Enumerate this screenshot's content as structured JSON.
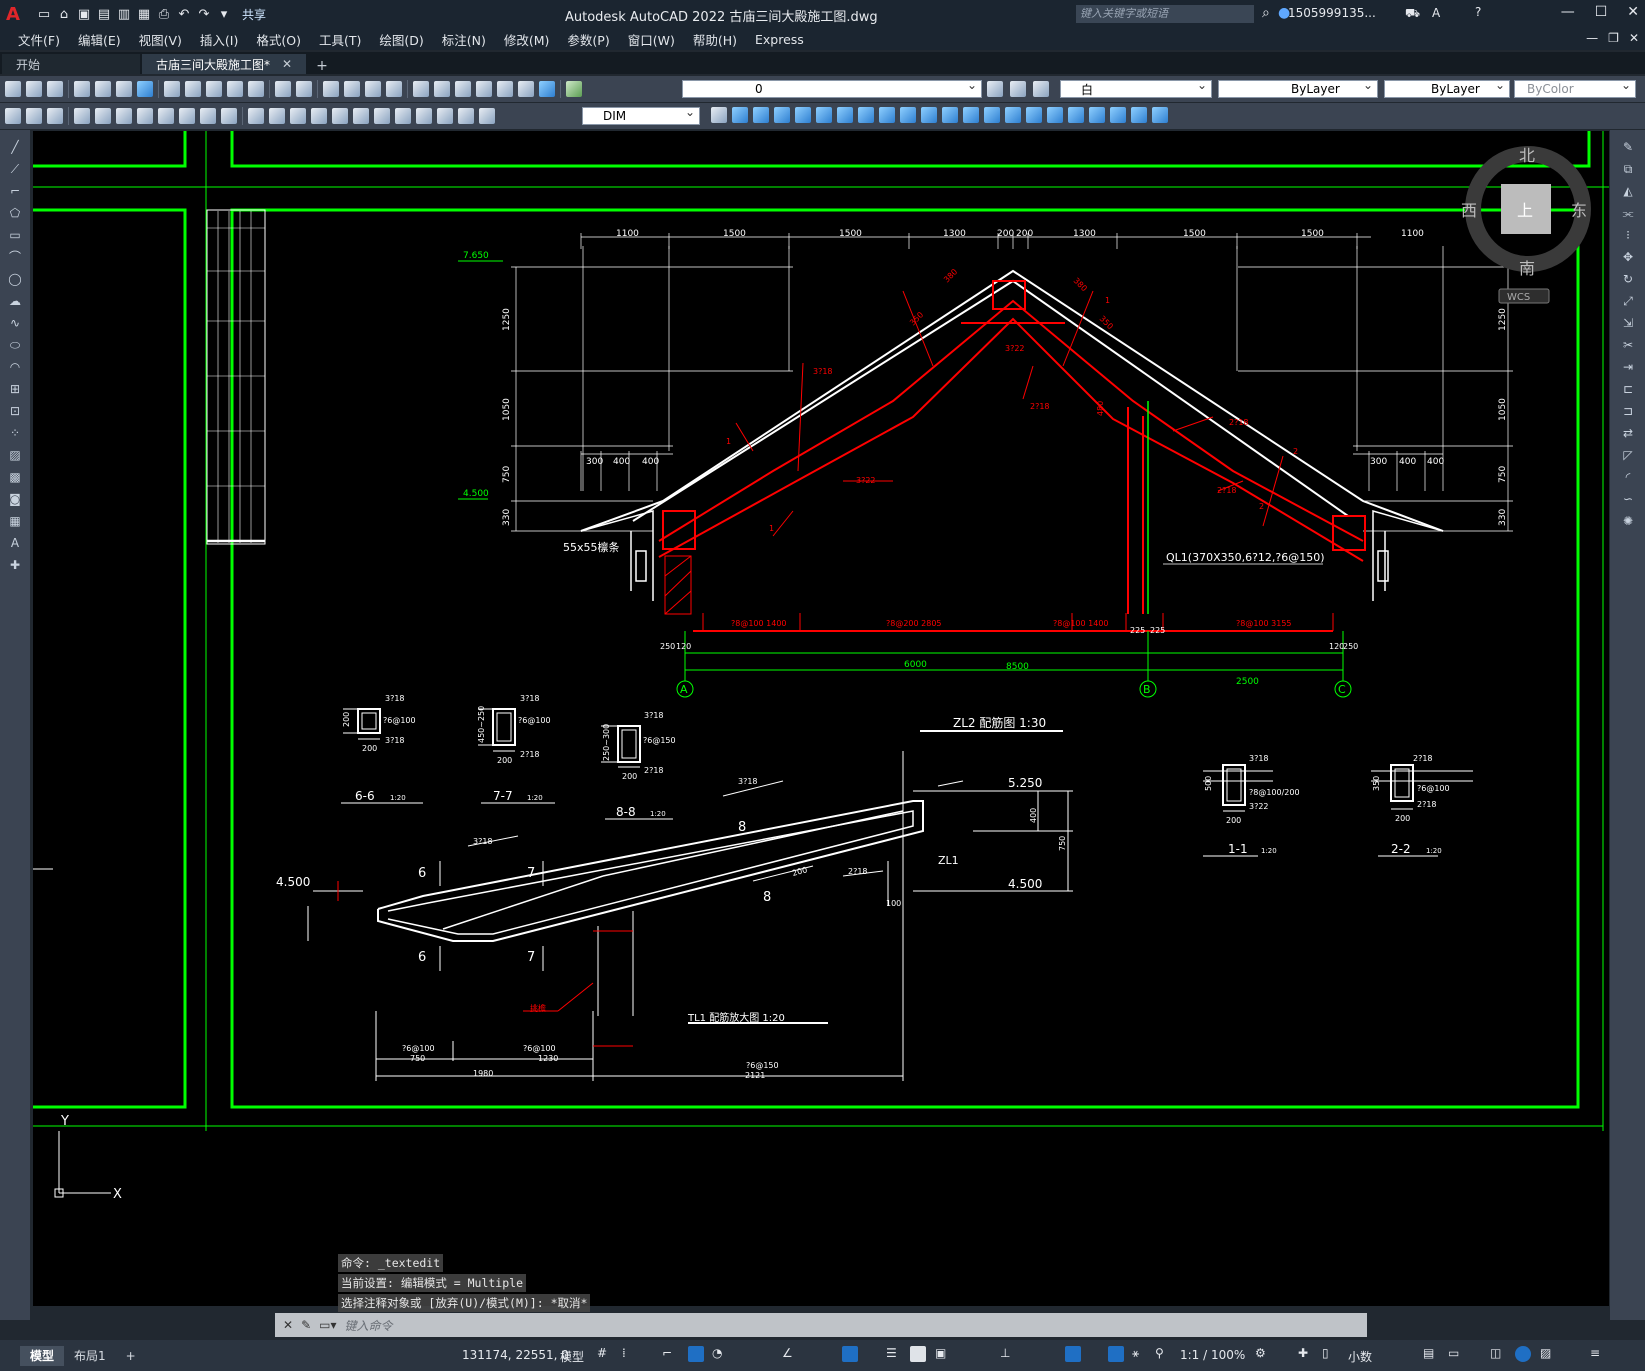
{
  "app": {
    "title": "Autodesk AutoCAD 2022    古庙三间大殿施工图.dwg",
    "logo": "A",
    "share": "共享",
    "search_placeholder": "键入关键字或短语",
    "user": "1505999135..."
  },
  "menu": [
    "文件(F)",
    "编辑(E)",
    "视图(V)",
    "插入(I)",
    "格式(O)",
    "工具(T)",
    "绘图(D)",
    "标注(N)",
    "修改(M)",
    "参数(P)",
    "窗口(W)",
    "帮助(H)",
    "Express"
  ],
  "tabs": {
    "start": "开始",
    "drawing": "古庙三间大殿施工图*"
  },
  "toolbar": {
    "layer": "0",
    "color": "白",
    "linetype": "ByLayer",
    "lineweight": "ByLayer",
    "plotstyle": "ByColor",
    "dimstyle": "DIM"
  },
  "viewcube": {
    "north": "北",
    "south": "南",
    "east": "东",
    "west": "西",
    "top": "上",
    "wcs": "WCS"
  },
  "drawing": {
    "elev_top": "7.650",
    "elev_mid": "4.500",
    "ql1": "QL1(370X350,6?12,?6@150)",
    "purlin": "55x55檩条",
    "axis": [
      "A",
      "B",
      "C"
    ],
    "dims_top": [
      "1100",
      "1500",
      "1500",
      "1300",
      "200",
      "200",
      "1300",
      "1500",
      "1500",
      "1100"
    ],
    "dims_bottom": [
      "250",
      "120",
      "?8@100 1400",
      "?8@200 2805",
      "?8@100 1400",
      "225",
      "225",
      "?8@100 3155",
      "120",
      "250"
    ],
    "dim_6000": "6000",
    "dim_2500": "2500",
    "dim_8500": "8500",
    "vert_dims": [
      "1250",
      "1050",
      "750",
      "330"
    ],
    "bar_small": [
      "300",
      "400",
      "400"
    ],
    "rebar_labels": [
      "3?18",
      "3?22",
      "3?22",
      "2?18",
      "3?18",
      "3?22",
      "2?18",
      "2?18",
      "1",
      "1",
      "1",
      "2",
      "2"
    ],
    "dim_380": "380",
    "dim_350": "350",
    "dim_380b": "380",
    "dim_480": "480",
    "sec66": {
      "label": "6-6",
      "scale": "1:20",
      "top": "3?18",
      "mid": "?6@100",
      "bot": "3?18",
      "h": "200",
      "w": "200"
    },
    "sec77": {
      "label": "7-7",
      "scale": "1:20",
      "top": "3?18",
      "mid": "?6@100",
      "bot": "2?18",
      "h": "450~250",
      "w": "200"
    },
    "sec88": {
      "label": "8-8",
      "scale": "1:20",
      "top": "3?18",
      "mid": "?6@150",
      "bot": "2?18",
      "h": "250~300",
      "w": "200"
    },
    "sec11": {
      "label": "1-1",
      "scale": "1:20",
      "top": "3?18",
      "mid": "?8@100/200",
      "bot": "3?22",
      "h": "500",
      "w": "200"
    },
    "sec22": {
      "label": "2-2",
      "scale": "1:20",
      "top": "2?18",
      "mid": "?6@100",
      "bot": "2?18",
      "h": "350",
      "w": "200"
    },
    "zl2": "ZL2 配筋图 1:30",
    "tl1": "TL1 配筋放大图 1:20",
    "elev_5250": "5.250",
    "elev_4500a": "4.500",
    "elev_4500b": "4.500",
    "zl1": "ZL1",
    "tiao": "挑檐",
    "d_750": "750",
    "d_1230": "1230",
    "d_1980": "1980",
    "d_2121": "2121",
    "r_1": "?6@100",
    "r_2": "?6@100",
    "r_3": "?6@150",
    "num6": "6",
    "num7": "7",
    "num8": "8",
    "sm_2_18": "2?18",
    "sm_3_18a": "3?18",
    "sm_3_18b": "3?18",
    "sm_200": "200",
    "sm_400": "400",
    "sm_750": "750",
    "sm_100": "100"
  },
  "command": {
    "h1": "命令: _textedit",
    "h2": "当前设置: 编辑模式 = Multiple",
    "h3": "选择注释对象或 [放弃(U)/模式(M)]: *取消*",
    "placeholder": "键入命令"
  },
  "status": {
    "model_tab": "模型",
    "layout_tab": "布局1",
    "coords": "131174, 22551, 0",
    "model": "模型",
    "zoom": "1:1 / 100%",
    "units": "小数"
  }
}
